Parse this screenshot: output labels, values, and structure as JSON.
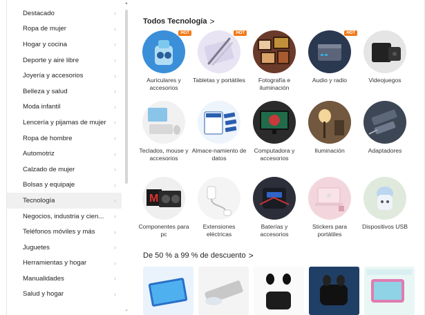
{
  "sidebar": {
    "items": [
      {
        "label": "Destacado"
      },
      {
        "label": "Ropa de mujer"
      },
      {
        "label": "Hogar y cocina"
      },
      {
        "label": "Deporte y aire libre"
      },
      {
        "label": "Joyería y accesorios"
      },
      {
        "label": "Belleza y salud"
      },
      {
        "label": "Moda infantil"
      },
      {
        "label": "Lencería y pijamas de mujer"
      },
      {
        "label": "Ropa de hombre"
      },
      {
        "label": "Automotriz"
      },
      {
        "label": "Calzado de mujer"
      },
      {
        "label": "Bolsas y equipaje"
      },
      {
        "label": "Tecnología"
      },
      {
        "label": "Negocios, industria y cien..."
      },
      {
        "label": "Teléfonos móviles y más"
      },
      {
        "label": "Juguetes"
      },
      {
        "label": "Herramientas y hogar"
      },
      {
        "label": "Manualidades"
      },
      {
        "label": "Salud y hogar"
      }
    ],
    "active_index": 12,
    "chevron": "›"
  },
  "main": {
    "section_title": "Todos Tecnología",
    "section_arrow": ">",
    "hot_label": "HOT",
    "categories": [
      {
        "label": "Auriculares y accesorios",
        "icon": "earbuds-icon",
        "hot": true
      },
      {
        "label": "Tabletas y portátiles",
        "icon": "stylus-tablet-icon",
        "hot": true
      },
      {
        "label": "Fotografía e iluminación",
        "icon": "photo-frames-icon",
        "hot": false
      },
      {
        "label": "Audio y radio",
        "icon": "mini-pc-icon",
        "hot": true
      },
      {
        "label": "Videojuegos",
        "icon": "game-console-icon",
        "hot": false
      },
      {
        "label": "Teclados, mouse y accesorios",
        "icon": "keyboard-icon",
        "hot": false
      },
      {
        "label": "Almace-namiento de datos",
        "icon": "storage-icon",
        "hot": false
      },
      {
        "label": "Computadora y accesorios",
        "icon": "monitor-icon",
        "hot": false
      },
      {
        "label": "Iluminación",
        "icon": "lamp-icon",
        "hot": false
      },
      {
        "label": "Adaptadores",
        "icon": "adapter-icon",
        "hot": false
      },
      {
        "label": "Componentes para pc",
        "icon": "graphics-card-icon",
        "hot": false
      },
      {
        "label": "Extensiones eléctricas",
        "icon": "power-strip-icon",
        "hot": false
      },
      {
        "label": "Baterías y accesorios",
        "icon": "power-bank-icon",
        "hot": false
      },
      {
        "label": "Stickers para portátiles",
        "icon": "laptop-sticker-icon",
        "hot": false
      },
      {
        "label": "Dispositivos USB",
        "icon": "usb-humidifier-icon",
        "hot": false
      }
    ],
    "discount_title": "De 50 % a 99 % de descuento",
    "discount_arrow": ">",
    "products": [
      {
        "icon": "tablet-product-icon"
      },
      {
        "icon": "dvd-drive-product-icon"
      },
      {
        "icon": "earbuds-product-icon"
      },
      {
        "icon": "gaming-earbuds-product-icon"
      },
      {
        "icon": "kids-tablet-product-icon"
      }
    ]
  }
}
